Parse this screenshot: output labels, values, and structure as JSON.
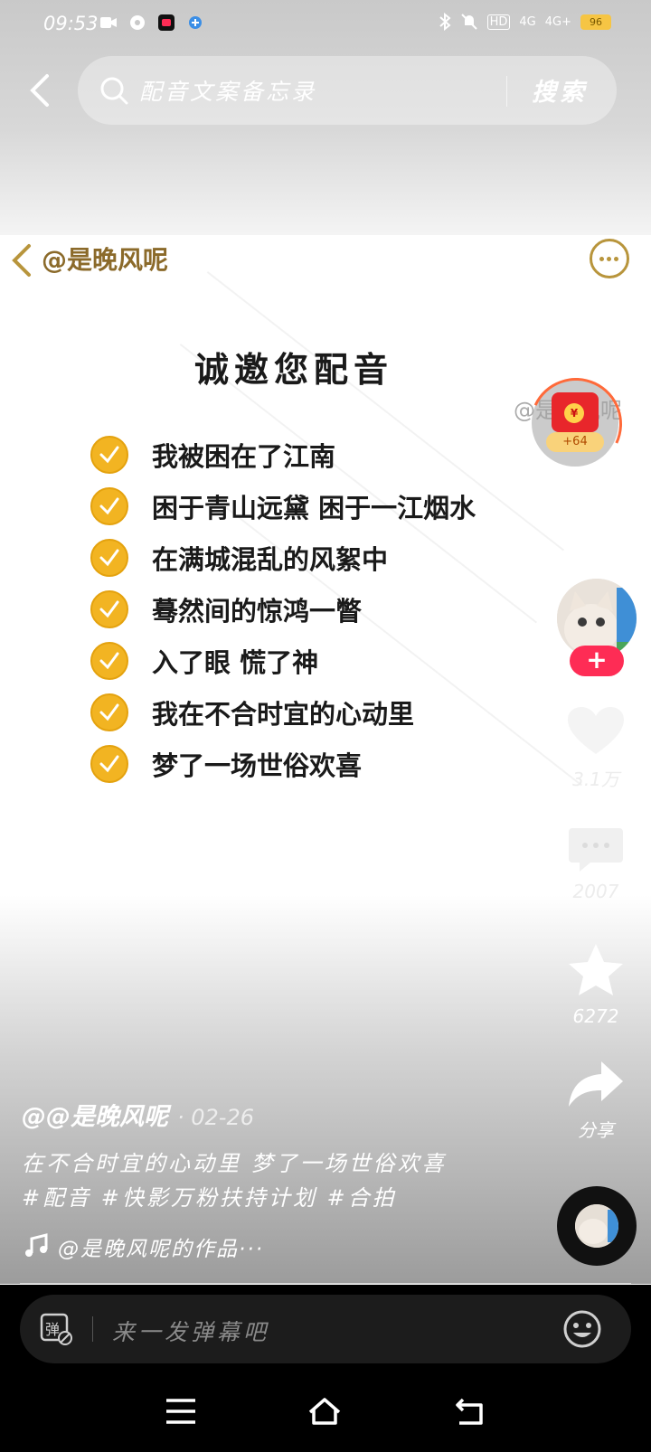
{
  "status_bar": {
    "time": "09:53",
    "battery": "96",
    "network1": "4G",
    "network2": "4G+",
    "hd": "HD"
  },
  "search": {
    "query": "配音文案备忘录",
    "button_label": "搜索"
  },
  "post": {
    "author_handle": "@是晚风呢",
    "title": "诚邀您配音",
    "lines": [
      "我被困在了江南",
      "困于青山远黛 困于一江烟水",
      "在满城混乱的风絮中",
      "蓦然间的惊鸿一瞥",
      "入了眼 慌了神",
      "我在不合时宜的心动里",
      "梦了一场世俗欢喜"
    ],
    "watermark": "@是晚风呢"
  },
  "red_packet": {
    "amount": "+64"
  },
  "rail": {
    "likes": "3.1万",
    "comments": "2007",
    "favorites": "6272",
    "share_label": "分享"
  },
  "caption": {
    "user": "@@是晚风呢",
    "date": "· 02-26",
    "text": "在不合时宜的心动里 梦了一场世俗欢喜 #配音 #快影万粉扶持计划 #合拍",
    "music": "@是晚风呢的作品···"
  },
  "danmaku": {
    "toggle_label": "弹",
    "placeholder": "来一发弹幕吧"
  },
  "colors": {
    "accent_gold": "#b8953c",
    "check_yellow": "#f2b422",
    "follow_pink": "#fe2c55"
  }
}
